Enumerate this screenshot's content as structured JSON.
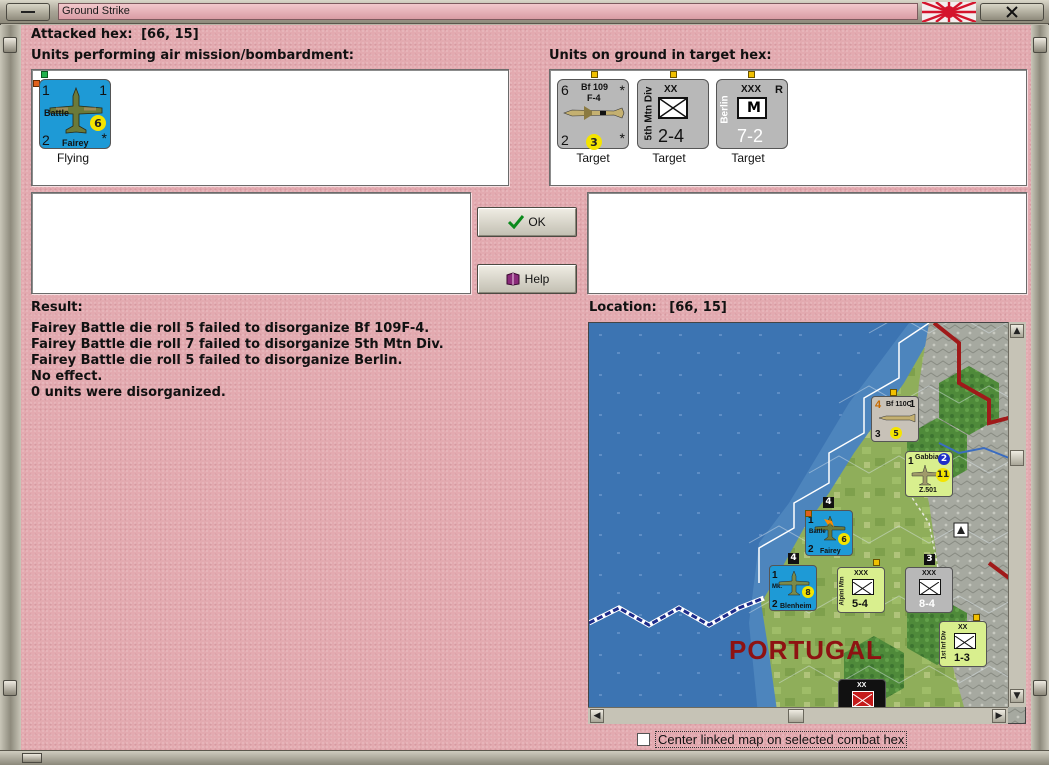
{
  "window": {
    "title": "Ground Strike"
  },
  "attacked_hex": {
    "label": "Attacked hex:",
    "value": "[66, 15]"
  },
  "air_panel": {
    "label": "Units performing air mission/bombardment:",
    "units": [
      {
        "top_left": "1",
        "top_right": "1",
        "name": "Battle",
        "maker": "Fairey",
        "bottom_left": "2",
        "circle": "6",
        "mark": "*",
        "caption": "Flying"
      }
    ]
  },
  "ground_panel": {
    "label": "Units on ground in target hex:",
    "units": [
      {
        "top_left": "6",
        "name": "Bf 109",
        "model": "F-4",
        "star_top": "*",
        "bottom_left": "2",
        "circle": "3",
        "star_bottom": "*",
        "caption": "Target"
      },
      {
        "size": "XX",
        "side_name": "5th Mtn Div",
        "strength": "2-4",
        "caption": "Target"
      },
      {
        "size": "XXX",
        "corner": "R",
        "side_name": "Berlin",
        "symbol_letter": "M",
        "strength": "7-2",
        "caption": "Target"
      }
    ]
  },
  "buttons": {
    "ok": "OK",
    "help": "Help"
  },
  "result": {
    "label": "Result:",
    "lines": [
      "Fairey Battle die roll 5 failed to disorganize Bf 109F-4.",
      "Fairey Battle die roll 7 failed to disorganize 5th Mtn Div.",
      "Fairey Battle die roll 5 failed to disorganize Berlin.",
      "No effect.",
      "0 units were disorganized."
    ]
  },
  "location": {
    "label": "Location:",
    "value": "[66, 15]"
  },
  "map": {
    "country_label": "PORTUGAL",
    "units": [
      {
        "id": "bf110",
        "top_left": "4",
        "name": "Bf 110C",
        "top_right": "1",
        "bottom_left": "3",
        "circle": "5",
        "stack": "1"
      },
      {
        "id": "gabbiano",
        "name": "Gabbiano",
        "model": "Z.501",
        "top_left": "1",
        "badge": "2",
        "circle": "11"
      },
      {
        "id": "fairey",
        "name": "Battle",
        "maker": "Fairey",
        "top_left": "1",
        "bottom_left": "2",
        "circle": "6",
        "stack": "4"
      },
      {
        "id": "blenheim",
        "name": "Mk.",
        "maker": "Blenheim",
        "top_left": "1",
        "bottom_left": "2",
        "circle": "8",
        "stack": "4"
      },
      {
        "id": "alpini",
        "size": "XXX",
        "side_name": "Alpini Mtn",
        "strength": "5-4"
      },
      {
        "id": "grey-corps",
        "size": "XXX",
        "strength": "8-4",
        "stack": "3"
      },
      {
        "id": "inf-div",
        "size": "XX",
        "side_name": "1st Inf Div",
        "strength": "1-3"
      },
      {
        "id": "red-unit",
        "size": "XX"
      }
    ]
  },
  "options": {
    "center_map_label": "Center linked map on selected combat hex",
    "center_map_checked": false
  },
  "colors": {
    "background": "#e3aab0",
    "air_unit": "#1e9ad6",
    "grey_unit": "#b8b8b8",
    "sea": "#3f77b4",
    "land": "#8fb05c",
    "border_red": "#a01a1a"
  }
}
